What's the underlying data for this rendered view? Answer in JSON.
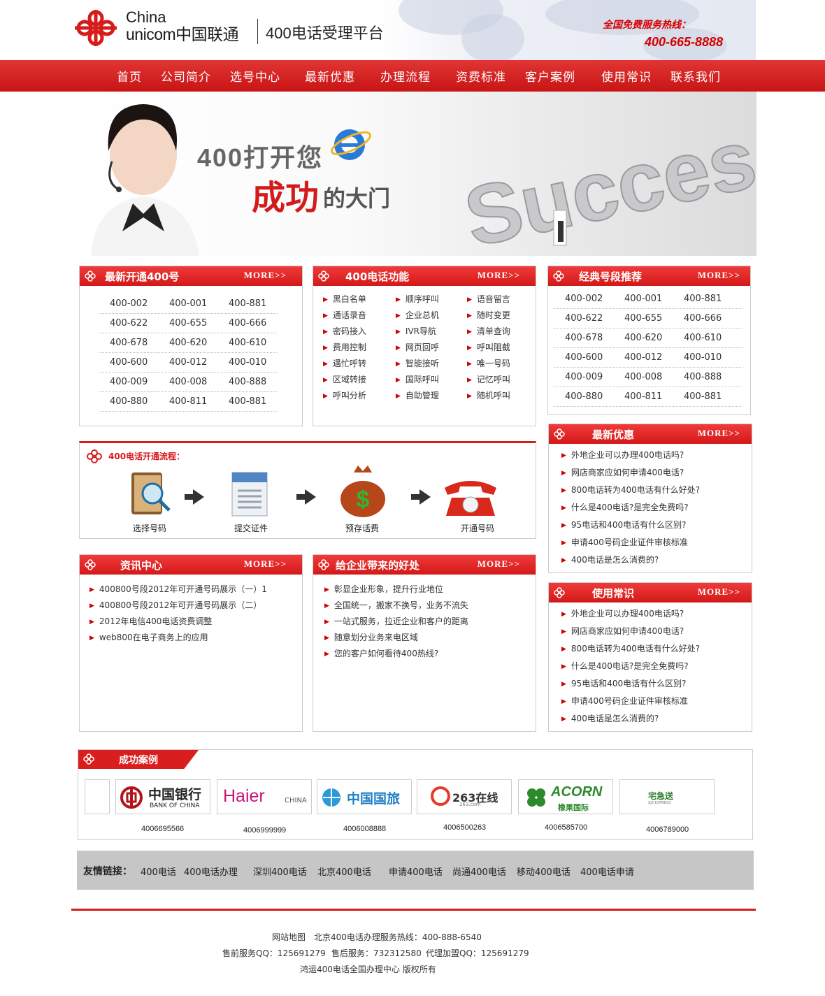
{
  "header": {
    "logo_china": "China",
    "logo_unicom": "unicom中国联通",
    "platform_title": "400电话受理平台",
    "hotline_label": "全国免费服务热线：",
    "hotline_number": "400-665-8888"
  },
  "nav": {
    "items": [
      "首页",
      "公司简介",
      "选号中心",
      "最新优惠",
      "办理流程",
      "资费标准",
      "客户案例",
      "使用常识",
      "联系我们"
    ]
  },
  "banner": {
    "line1": "400打开您",
    "line2_red": "成功",
    "line2_grey": "的大门",
    "success_word": "Success"
  },
  "new_numbers": {
    "title": "最新开通400号",
    "more": "MORE>>",
    "rows": [
      [
        "400-002",
        "400-001",
        "400-881"
      ],
      [
        "400-622",
        "400-655",
        "400-666"
      ],
      [
        "400-678",
        "400-620",
        "400-610"
      ],
      [
        "400-600",
        "400-012",
        "400-010"
      ],
      [
        "400-009",
        "400-008",
        "400-888"
      ],
      [
        "400-880",
        "400-811",
        "400-881"
      ]
    ]
  },
  "functions": {
    "title": "400电话功能",
    "more": "MORE>>",
    "columns": [
      [
        "黑白名单",
        "通话录音",
        "密码接入",
        "费用控制",
        "遇忙呼转",
        "区域转接",
        "呼叫分析"
      ],
      [
        "顺序呼叫",
        "企业总机",
        "IVR导航",
        "网页回呼",
        "智能接听",
        "国际呼叫",
        "自助管理"
      ],
      [
        "语音留言",
        "随时变更",
        "清单查询",
        "呼叫阻截",
        "唯一号码",
        "记忆呼叫",
        "随机呼叫"
      ]
    ]
  },
  "classic_numbers": {
    "title": "经典号段推荐",
    "more": "MORE>>",
    "rows": [
      [
        "400-002",
        "400-001",
        "400-881"
      ],
      [
        "400-622",
        "400-655",
        "400-666"
      ],
      [
        "400-678",
        "400-620",
        "400-610"
      ],
      [
        "400-600",
        "400-012",
        "400-010"
      ],
      [
        "400-009",
        "400-008",
        "400-888"
      ],
      [
        "400-880",
        "400-811",
        "400-881"
      ]
    ]
  },
  "process": {
    "title": "400电话开通流程：",
    "steps": [
      "选择号码",
      "提交证件",
      "预存话费",
      "开通号码"
    ]
  },
  "promotions": {
    "title": "最新优惠",
    "more": "MORE>>",
    "items": [
      "外地企业可以办理400电话吗?",
      "网店商家应如何申请400电话?",
      "800电话转为400电话有什么好处?",
      "什么是400电话?是完全免费吗?",
      "95电话和400电话有什么区别?",
      "申请400号码企业证件审核标准",
      "400电话是怎么消费的?"
    ]
  },
  "news": {
    "title": "资讯中心",
    "more": "MORE>>",
    "items": [
      "400800号段2012年可开通号码展示（一）1",
      "400800号段2012年可开通号码展示（二）",
      "2012年电信400电话资费调整",
      "web800在电子商务上的应用"
    ]
  },
  "benefits": {
    "title": "给企业带来的好处",
    "more": "MORE>>",
    "items": [
      "彰显企业形象，提升行业地位",
      "全国统一，搬家不换号，业务不流失",
      "一站式服务，拉近企业和客户的距离",
      "随意划分业务来电区域",
      "您的客户如何看待400热线?"
    ]
  },
  "tips": {
    "title": "使用常识",
    "more": "MORE>>",
    "items": [
      "外地企业可以办理400电话吗?",
      "网店商家应如何申请400电话?",
      "800电话转为400电话有什么好处?",
      "什么是400电话?是完全免费吗?",
      "95电话和400电话有什么区别?",
      "申请400号码企业证件审核标准",
      "400电话是怎么消费的?"
    ]
  },
  "cases": {
    "title": "成功案例",
    "logos": [
      {
        "name": "中国银行",
        "sub": "BANK OF CHINA",
        "number": "4006695566"
      },
      {
        "name": "Haier",
        "sub": "CHINA",
        "number": "4006999999"
      },
      {
        "name": "中国国旅",
        "sub": "",
        "number": "4006008888"
      },
      {
        "name": "263在线",
        "sub": "263.com",
        "number": "4006500263"
      },
      {
        "name": "ACORN",
        "sub": "橡果国际",
        "number": "4006585700"
      },
      {
        "name": "宅急送",
        "sub": "ZJS EXPRESS",
        "number": "4006789000"
      }
    ]
  },
  "links": {
    "label": "友情链接：",
    "items": [
      "400电话",
      "400电话办理",
      "深圳400电话",
      "北京400电话",
      "申请400电话",
      "尚通400电话",
      "移动400电话",
      "400电话申请"
    ]
  },
  "footer": {
    "sitemap": "网站地图",
    "hotline": "北京400电话办理服务热线：400-888-6540",
    "presale": "售前服务QQ：125691279",
    "aftersale": "售后服务：732312580",
    "agent": "代理加盟QQ：125691279",
    "copyright": "鸿运400电话全国办理中心 版权所有"
  },
  "colors": {
    "brand_red": "#d71c1c",
    "nav_red": "#c81414"
  }
}
